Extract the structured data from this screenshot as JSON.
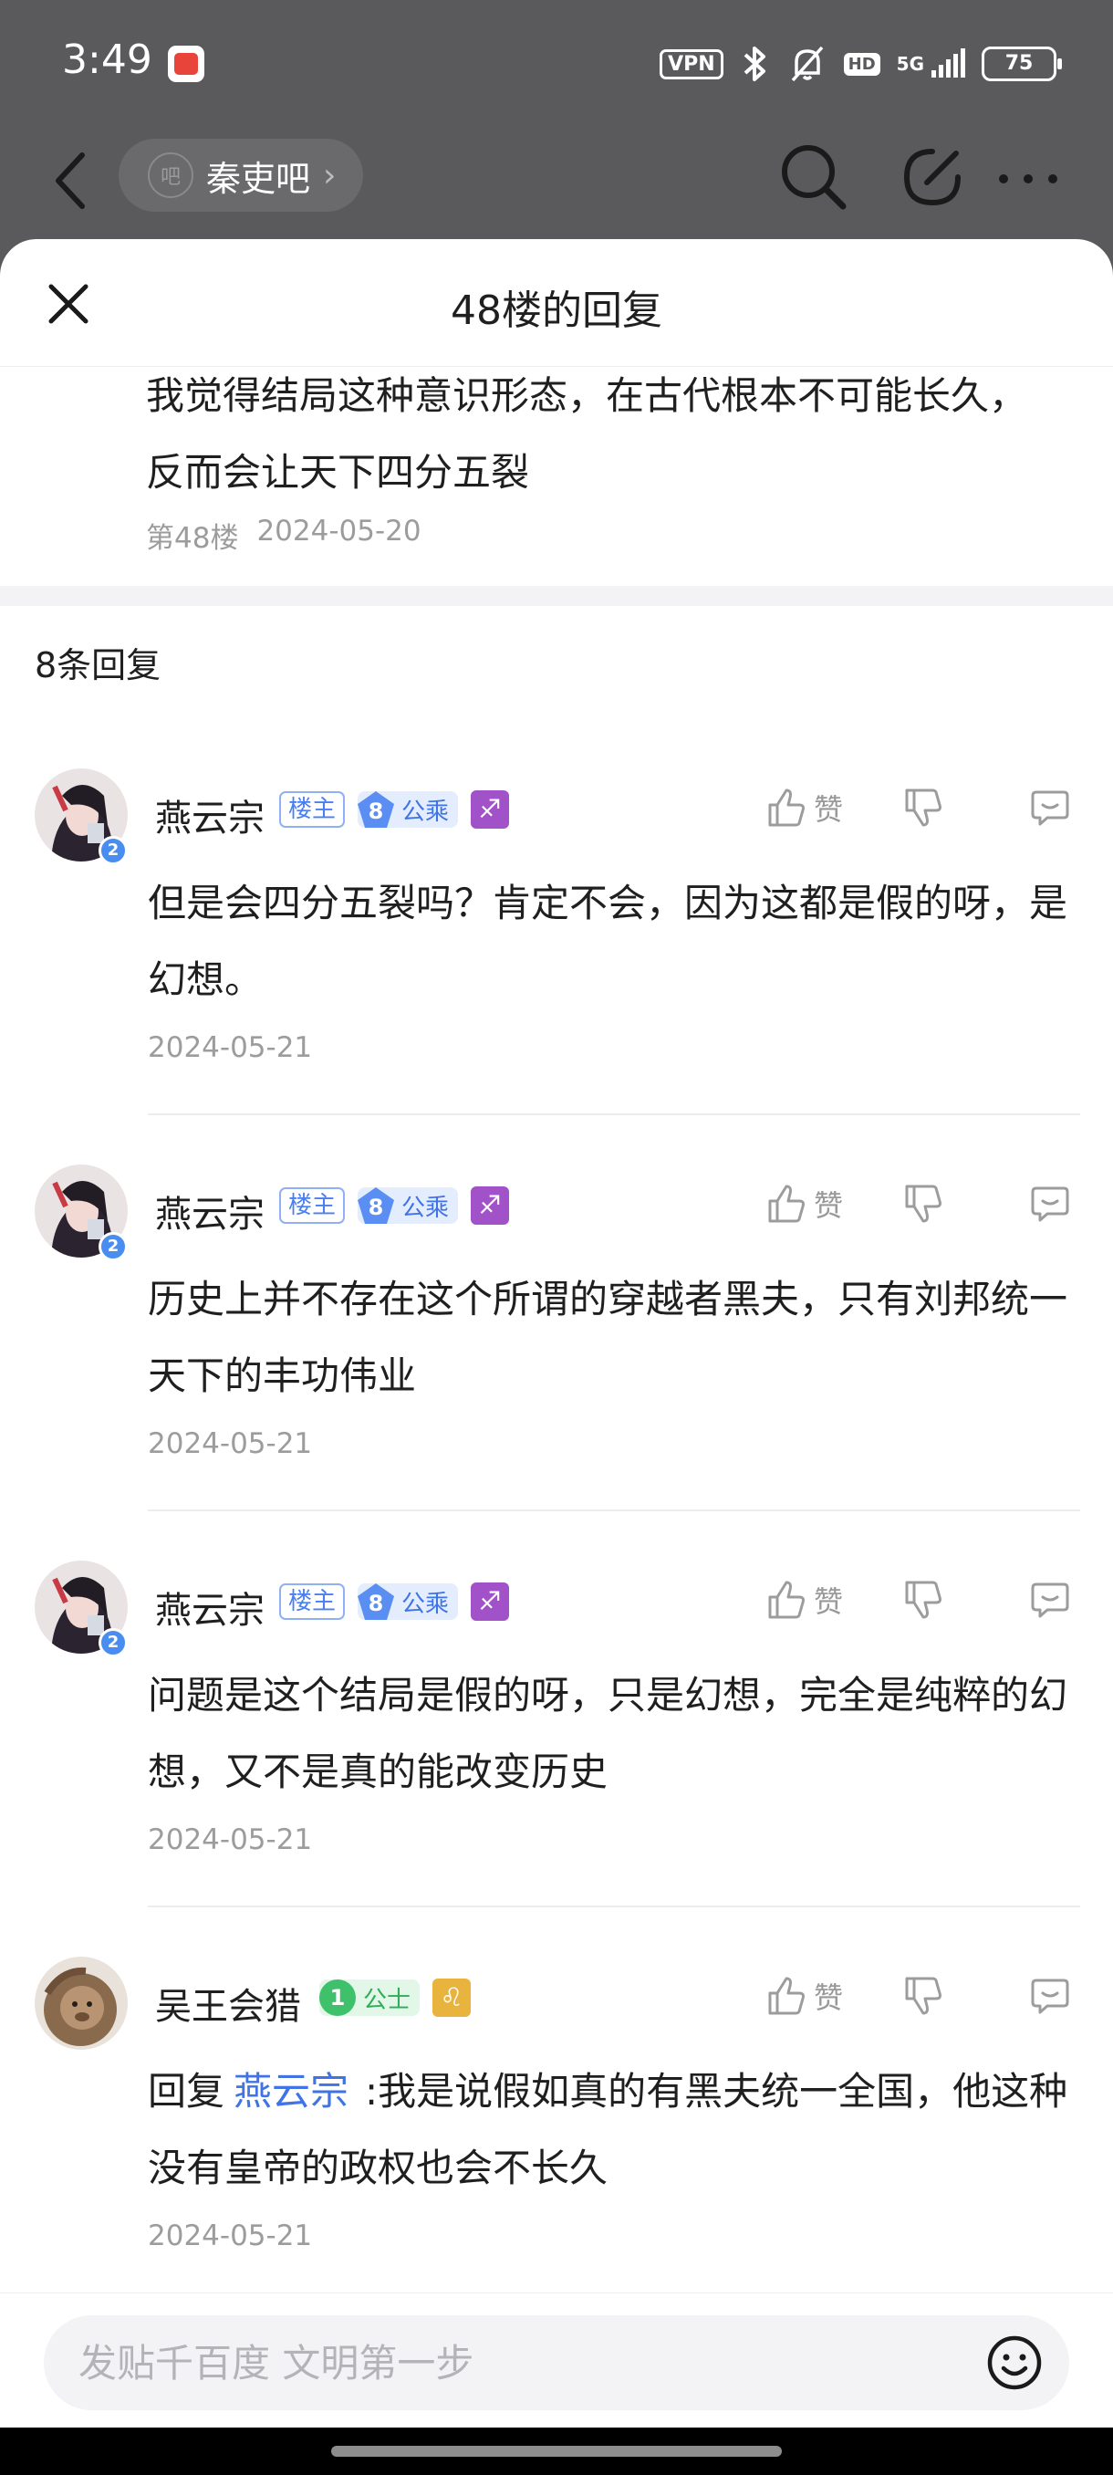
{
  "status_bar": {
    "time": "3:49",
    "vpn": "VPN",
    "hd": "HD",
    "network": "5G",
    "battery": "75"
  },
  "top_bar": {
    "forum_logo": "吧",
    "forum_name": "秦吏吧",
    "icons": [
      "back-icon",
      "search-icon",
      "edit-icon",
      "more-icon"
    ]
  },
  "sheet": {
    "title": "48楼的回复",
    "original_post": {
      "text": "我觉得结局这种意识形态，在古代根本不可能长久，反而会让天下四分五裂",
      "floor": "第48楼",
      "date": "2024-05-20"
    },
    "reply_count": "8条回复",
    "like_label": "赞",
    "replies": [
      {
        "user": "燕云宗",
        "owner_badge": "楼主",
        "level": "8",
        "level_title": "公乘",
        "zodiac": "♐",
        "text": "但是会四分五裂吗？肯定不会，因为这都是假的呀，是幻想。",
        "date": "2024-05-21"
      },
      {
        "user": "燕云宗",
        "owner_badge": "楼主",
        "level": "8",
        "level_title": "公乘",
        "zodiac": "♐",
        "text": "历史上并不存在这个所谓的穿越者黑夫，只有刘邦统一天下的丰功伟业",
        "date": "2024-05-21"
      },
      {
        "user": "燕云宗",
        "owner_badge": "楼主",
        "level": "8",
        "level_title": "公乘",
        "zodiac": "♐",
        "text": "问题是这个结局是假的呀，只是幻想，完全是纯粹的幻想，又不是真的能改变历史",
        "date": "2024-05-21"
      },
      {
        "user": "吴王会猎",
        "level": "1",
        "level_title": "公士",
        "zodiac": "♌",
        "reply_prefix": "回复",
        "mention": "燕云宗",
        "text": ":我是说假如真的有黑夫统一全国，他这种没有皇帝的政权也会不长久",
        "date": "2024-05-21"
      }
    ]
  },
  "input": {
    "placeholder": "发贴千百度 文明第一步"
  },
  "colors": {
    "accent_blue": "#3f73e6",
    "level_green": "#3fc06b",
    "zodiac_purple": "#a252c9",
    "zodiac_gold": "#e8b43d"
  }
}
